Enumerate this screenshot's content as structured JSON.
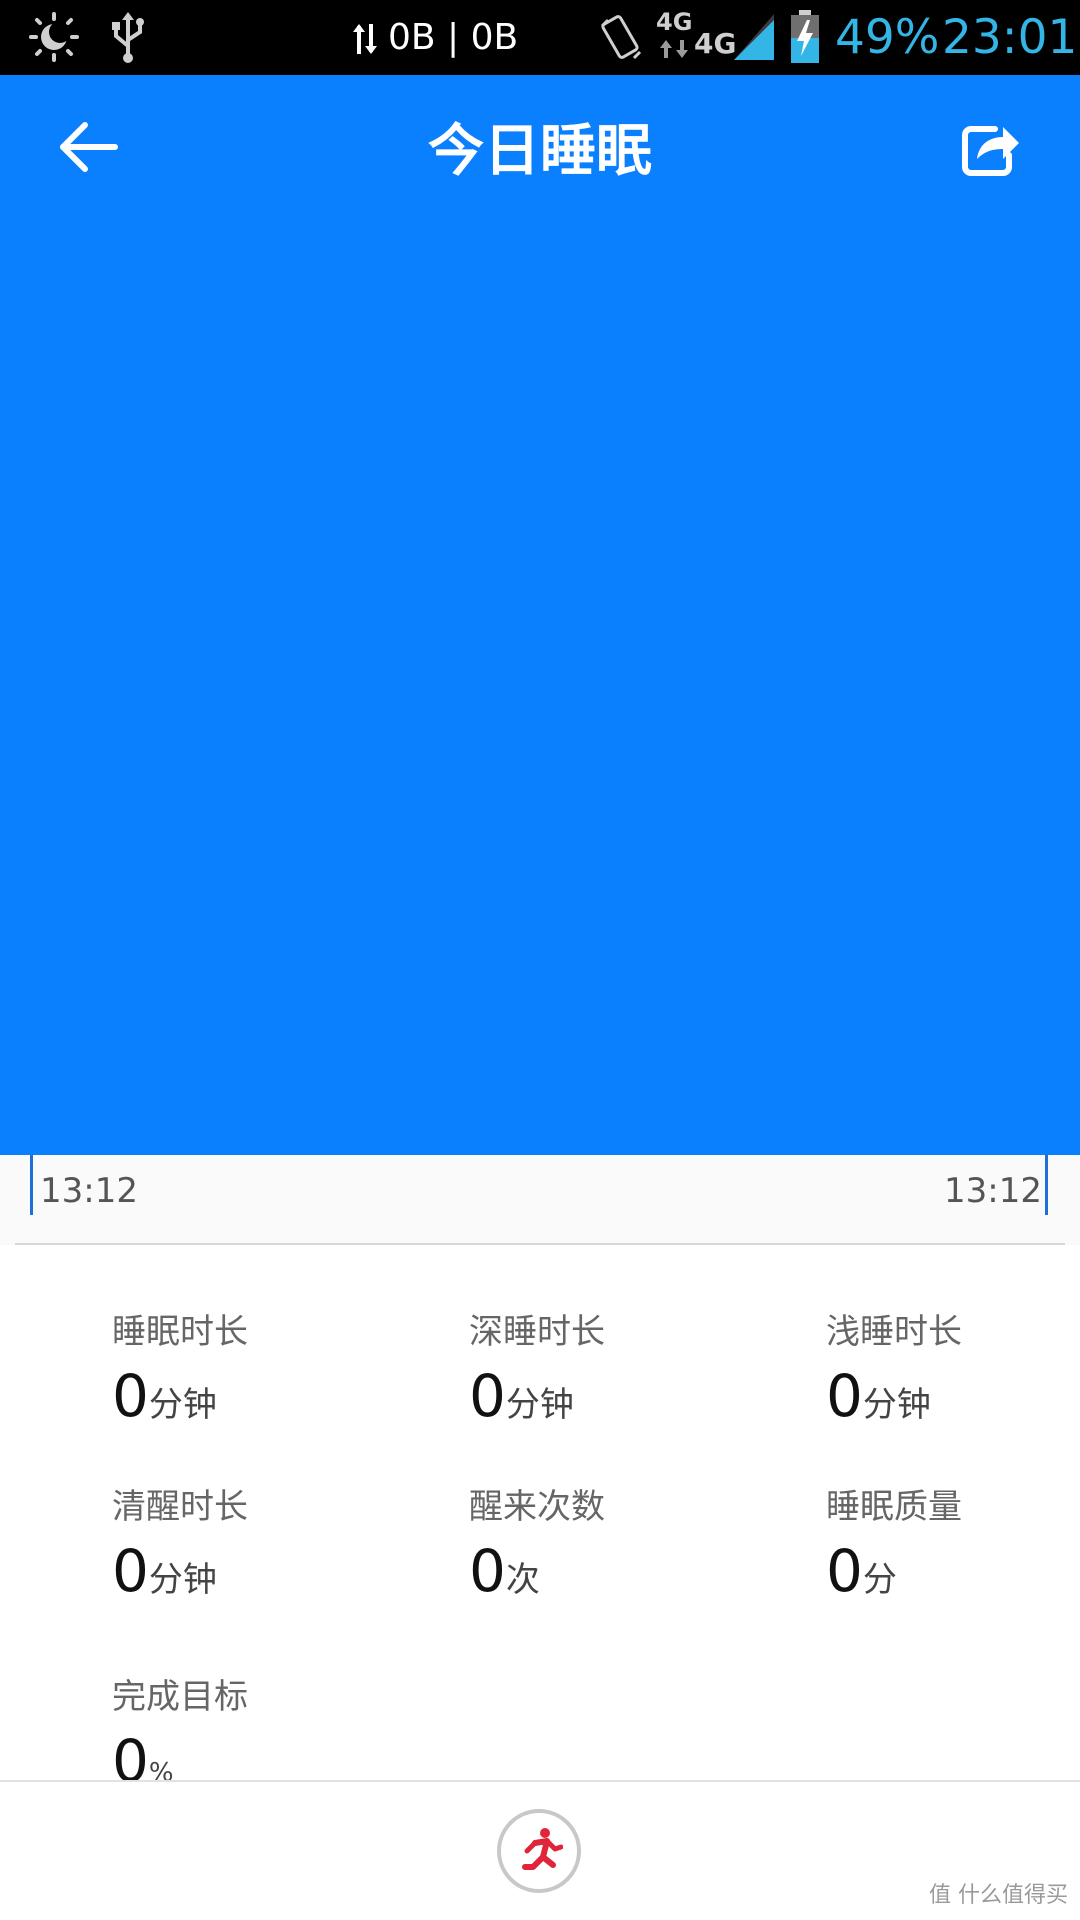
{
  "status_bar": {
    "network_speed": "0B | 0B",
    "network_type_1": "4G",
    "network_type_2": "4G",
    "battery_percent": "49%",
    "time": "23:01",
    "colors": {
      "background": "#000000",
      "accent": "#33b5e5"
    }
  },
  "header": {
    "title": "今日睡眠",
    "back_icon": "arrow-left-icon",
    "share_icon": "share-icon",
    "background_color": "#0a80ff"
  },
  "timeline": {
    "start_time": "13:12",
    "end_time": "13:12"
  },
  "stats": [
    {
      "label": "睡眠时长",
      "value": "0",
      "unit": "分钟"
    },
    {
      "label": "深睡时长",
      "value": "0",
      "unit": "分钟"
    },
    {
      "label": "浅睡时长",
      "value": "0",
      "unit": "分钟"
    },
    {
      "label": "清醒时长",
      "value": "0",
      "unit": "分钟"
    },
    {
      "label": "醒来次数",
      "value": "0",
      "unit": "次"
    },
    {
      "label": "睡眠质量",
      "value": "0",
      "unit": "分"
    },
    {
      "label": "完成目标",
      "value": "0",
      "unit": "%"
    }
  ],
  "bottom_bar": {
    "run_icon": "running-man-icon",
    "run_icon_color": "#e0253a"
  },
  "watermark": "值 什么值得买"
}
